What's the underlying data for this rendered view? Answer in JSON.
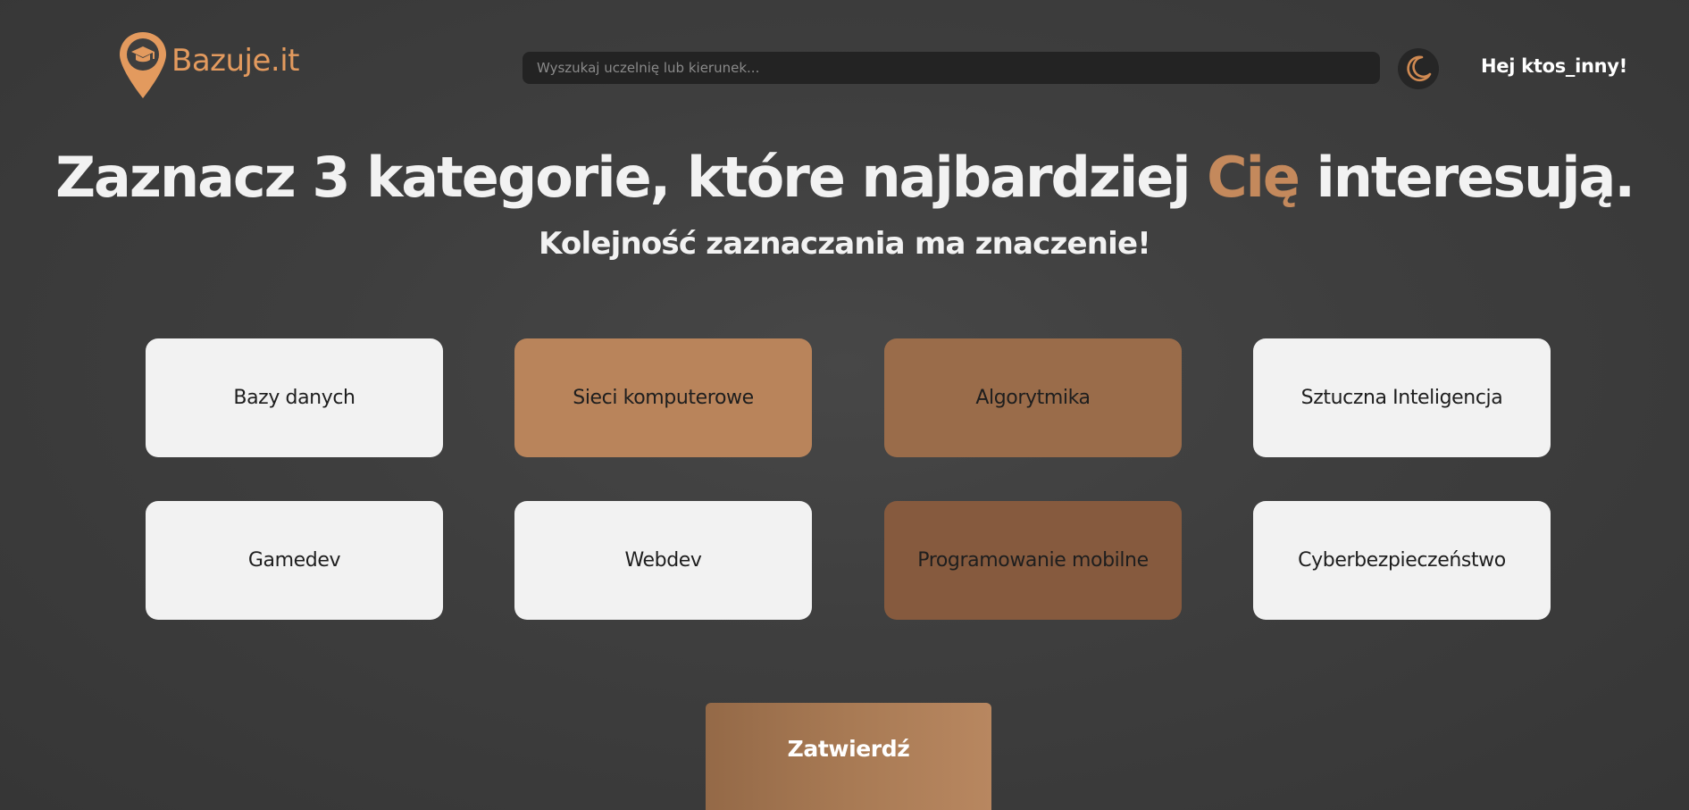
{
  "header": {
    "logo_text": "Bazuje.it",
    "search_placeholder": "Wyszukaj uczelnię lub kierunek...",
    "theme_toggle_icon": "moon-icon",
    "greeting": "Hej ktos_inny!"
  },
  "main": {
    "title_before": "Zaznacz 3 kategorie, które najbardziej ",
    "title_accent": "Cię",
    "title_after": " interesują.",
    "subtitle": "Kolejność zaznaczania ma znaczenie!",
    "categories": [
      {
        "label": "Bazy danych",
        "selected": false
      },
      {
        "label": "Sieci komputerowe",
        "selected": true,
        "order": 1
      },
      {
        "label": "Algorytmika",
        "selected": true,
        "order": 2
      },
      {
        "label": "Sztuczna Inteligencja",
        "selected": false
      },
      {
        "label": "Gamedev",
        "selected": false
      },
      {
        "label": "Webdev",
        "selected": false
      },
      {
        "label": "Programowanie mobilne",
        "selected": true,
        "order": 3
      },
      {
        "label": "Cyberbezpieczeństwo",
        "selected": false
      }
    ],
    "submit_label": "Zatwierdź"
  },
  "colors": {
    "accent": "#e39a5e",
    "background": "#3f3f3f",
    "card": "#f2f2f2",
    "selected_1": "#b9845b",
    "selected_2": "#9a6c4a",
    "selected_3": "#865a3e",
    "search_bg": "#232323"
  }
}
